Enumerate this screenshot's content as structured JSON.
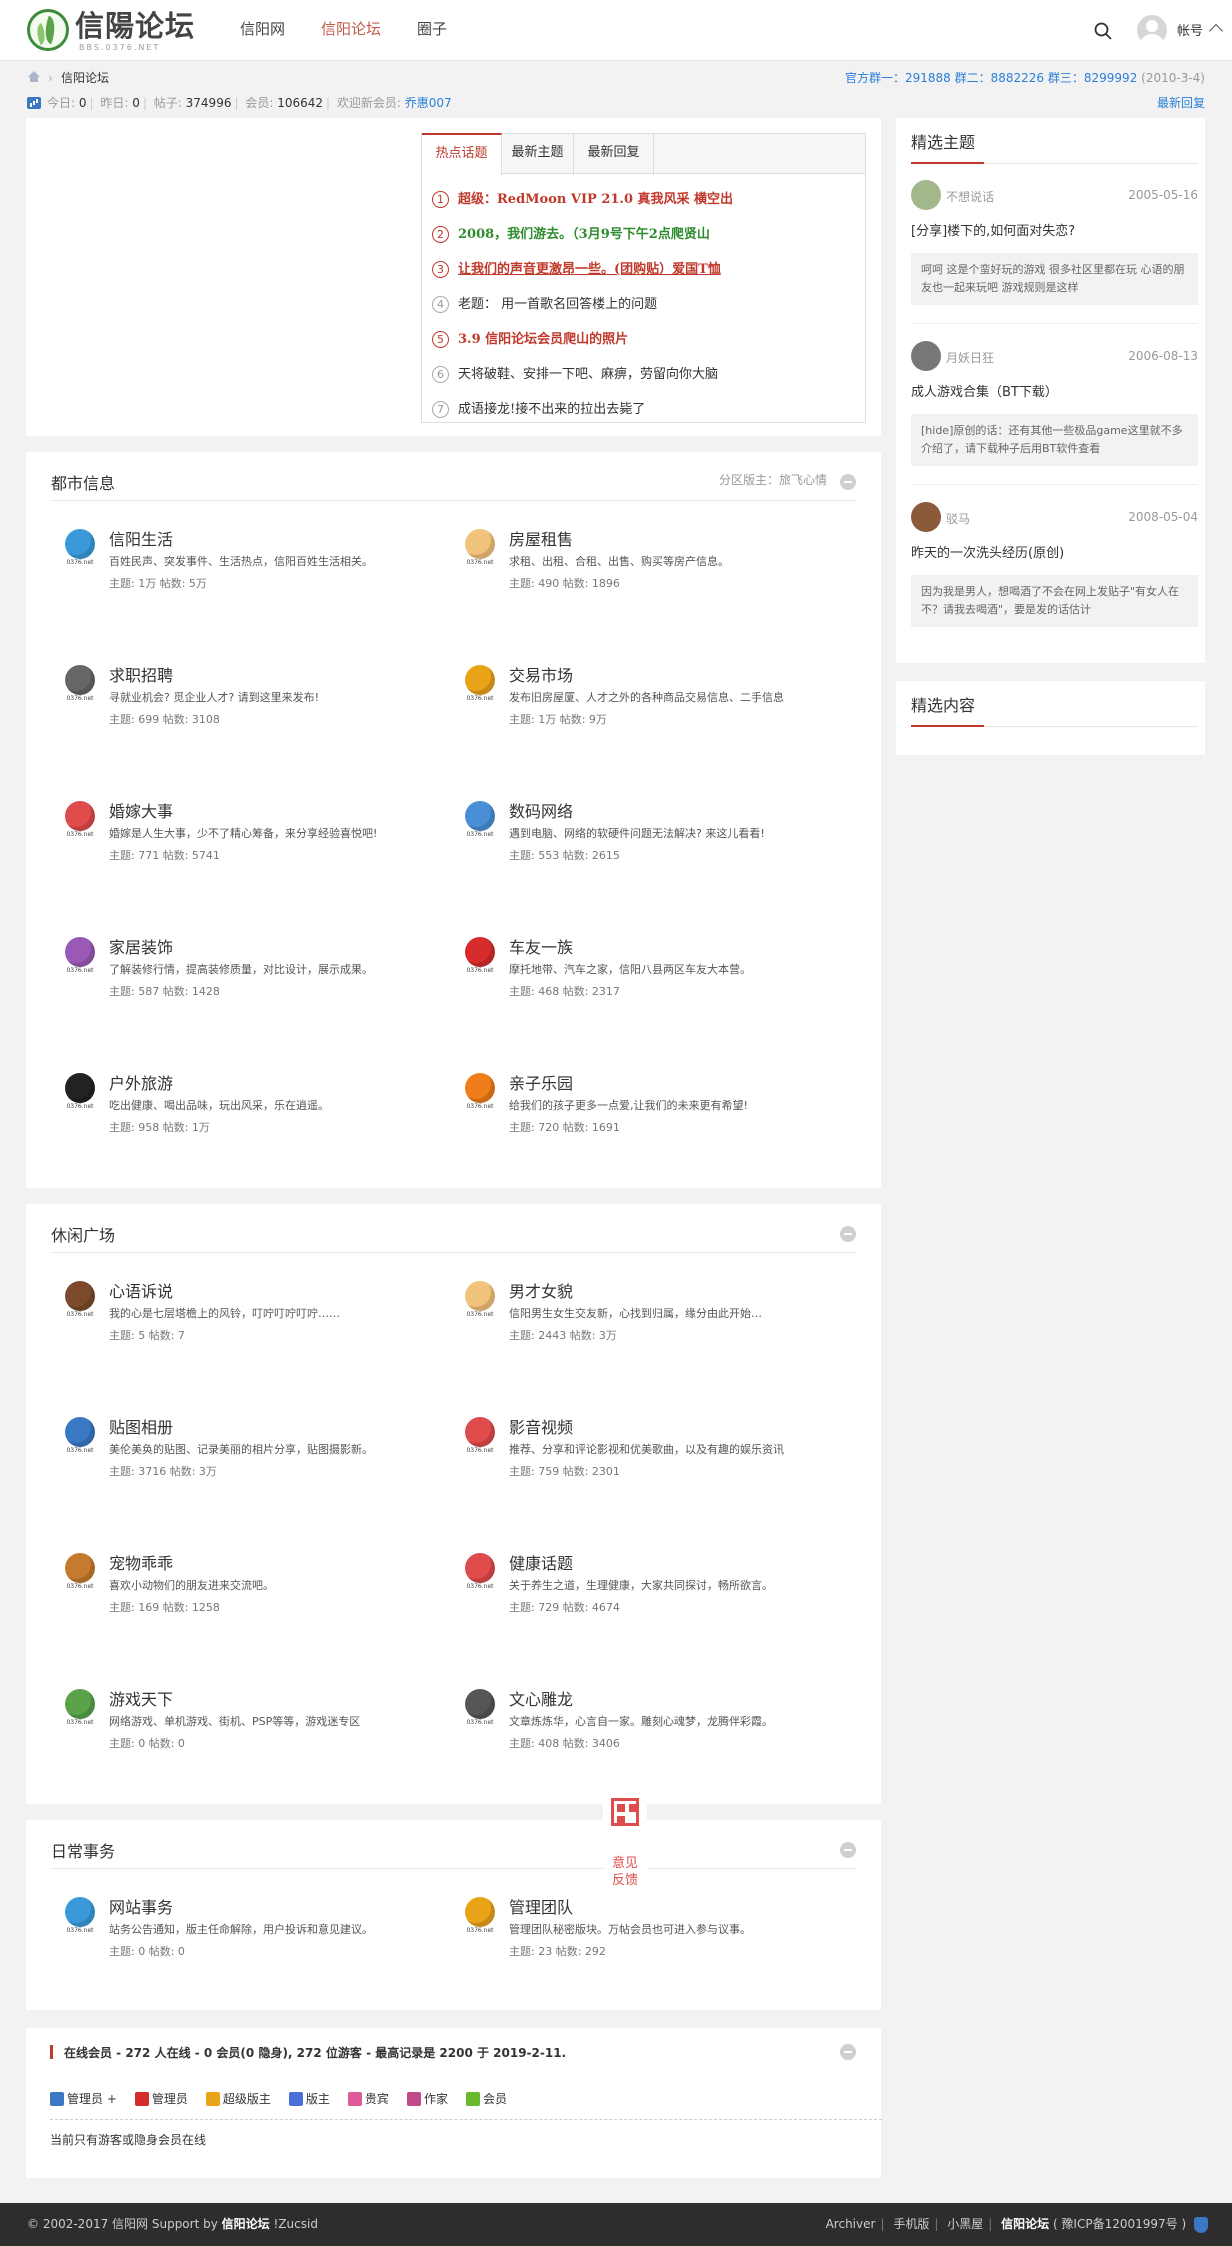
{
  "header": {
    "logo_text": "信陽论坛",
    "logo_sub": "BBS.0376.NET",
    "nav": [
      "信阳网",
      "信阳论坛",
      "圈子"
    ],
    "account": "帐号"
  },
  "breadcrumb": {
    "current": "信阳论坛",
    "qq_groups": "官方群一：291888 群二：8882226 群三：8299992",
    "date": "(2010-3-4)"
  },
  "stats": {
    "today_label": "今日:",
    "today": "0",
    "yesterday_label": "昨日:",
    "yesterday": "0",
    "posts_label": "帖子:",
    "posts": "374996",
    "members_label": "会员:",
    "members": "106642",
    "welcome_label": "欢迎新会员:",
    "newest_member": "乔惠007",
    "new_replies": "最新回复"
  },
  "hot": {
    "tabs": [
      "热点话题",
      "最新主题",
      "最新回复"
    ],
    "items": [
      {
        "n": "1",
        "text": "超级：RedMoon VIP 21.0 真我风采 横空出",
        "color": "#c0392b",
        "bold": true
      },
      {
        "n": "2",
        "text": "2008，我们游去。（3月9号下午2点爬贤山",
        "color": "#2e8b2e",
        "bold": true
      },
      {
        "n": "3",
        "text": "让我们的声音更激昂一些。(团购贴）爱国T恤",
        "color": "#c0392b",
        "bold": true,
        "underline": true
      },
      {
        "n": "4",
        "text": "老题：  用一首歌名回答楼上的问题",
        "color": "#333333",
        "bold": false
      },
      {
        "n": "5",
        "text": "3.9 信阳论坛会员爬山的照片",
        "color": "#c0392b",
        "bold": true
      },
      {
        "n": "6",
        "text": "天将破鞋、安排一下吧、麻痹，劳留向你大脑",
        "color": "#333333",
        "bold": false
      },
      {
        "n": "7",
        "text": "成语接龙!接不出来的拉出去毙了",
        "color": "#333333",
        "bold": false
      }
    ]
  },
  "sections": [
    {
      "title": "都市信息",
      "moderator": "分区版主：旅飞心情",
      "forums": [
        {
          "name": "信阳生活",
          "desc": "百姓民声、突发事件、生活热点，信阳百姓生活相关。",
          "count": "主题: 1万 帖数: 5万",
          "icon": "globe-icon",
          "color": "#3a9ad9"
        },
        {
          "name": "房屋租售",
          "desc": "求租、出租、合租、出售、购买等房产信息。",
          "count": "主题: 490 帖数: 1896",
          "icon": "speech-bubble-icon",
          "color": "#f0c27a"
        },
        {
          "name": "求职招聘",
          "desc": "寻就业机会? 觅企业人才? 请到这里来发布!",
          "count": "主题: 699 帖数: 3108",
          "icon": "compass-icon",
          "color": "#666666"
        },
        {
          "name": "交易市场",
          "desc": "发布旧房屋厦、人才之外的各种商品交易信息、二手信息",
          "count": "主题: 1万 帖数: 9万",
          "icon": "coins-icon",
          "color": "#e8a317"
        },
        {
          "name": "婚嫁大事",
          "desc": "婚嫁是人生大事，少不了精心筹备，来分享经验喜悦吧!",
          "count": "主题: 771 帖数: 5741",
          "icon": "heart-icon",
          "color": "#e04b4b"
        },
        {
          "name": "数码网络",
          "desc": "遇到电脑、网络的软硬件问题无法解决? 来这儿看看!",
          "count": "主题: 553 帖数: 2615",
          "icon": "monitor-icon",
          "color": "#4a8fd6"
        },
        {
          "name": "家居装饰",
          "desc": "了解装修行情，提高装修质量，对比设计，展示成果。",
          "count": "主题: 587 帖数: 1428",
          "icon": "lamp-icon",
          "color": "#9b59b6"
        },
        {
          "name": "车友一族",
          "desc": "摩托地带、汽车之家，信阳八县两区车友大本营。",
          "count": "主题: 468 帖数: 2317",
          "icon": "car-icon",
          "color": "#d62c2c"
        },
        {
          "name": "户外旅游",
          "desc": "吃出健康、喝出品味，玩出风采，乐在逍遥。",
          "count": "主题: 958 帖数: 1万",
          "icon": "camera-icon",
          "color": "#222222"
        },
        {
          "name": "亲子乐园",
          "desc": "给我们的孩子更多一点爱,让我们的未来更有希望!",
          "count": "主题: 720 帖数: 1691",
          "icon": "mushroom-icon",
          "color": "#f07c1a"
        }
      ]
    },
    {
      "title": "休闲广场",
      "moderator": "",
      "forums": [
        {
          "name": "心语诉说",
          "desc": "我的心是七层塔檐上的风铃，叮咛叮咛叮咛……",
          "count": "主题: 5 帖数: 7",
          "icon": "coffee-cup-icon",
          "color": "#7a4a2a"
        },
        {
          "name": "男才女貌",
          "desc": "信阳男生女生交友新，心找到归属，缘分由此开始…",
          "count": "主题: 2443 帖数: 3万",
          "icon": "speech-bubble-icon",
          "color": "#f0c27a"
        },
        {
          "name": "贴图相册",
          "desc": "美伦美奂的贴图、记录美丽的相片分享，贴图摄影新。",
          "count": "主题: 3716 帖数: 3万",
          "icon": "picture-icon",
          "color": "#3a78c4"
        },
        {
          "name": "影音视频",
          "desc": "推荐、分享和评论影视和优美歌曲，以及有趣的娱乐资讯",
          "count": "主题: 759 帖数: 2301",
          "icon": "disc-icon",
          "color": "#e04b4b"
        },
        {
          "name": "宠物乖乖",
          "desc": "喜欢小动物们的朋友进来交流吧。",
          "count": "主题: 169 帖数: 1258",
          "icon": "dog-icon",
          "color": "#c57a2e"
        },
        {
          "name": "健康话题",
          "desc": "关于养生之道，生理健康，大家共同探讨，畅所欲言。",
          "count": "主题: 729 帖数: 4674",
          "icon": "health-pin-icon",
          "color": "#e04b4b"
        },
        {
          "name": "游戏天下",
          "desc": "网络游戏、单机游戏、街机、PSP等等，游戏迷专区",
          "count": "主题: 0 帖数: 0",
          "icon": "gamepad-icon",
          "color": "#5aa34a"
        },
        {
          "name": "文心雕龙",
          "desc": "文章炼炼华，心言自一家。雕刻心魂梦，龙腾伴彩霞。",
          "count": "主题: 408 帖数: 3406",
          "icon": "notebook-icon",
          "color": "#555555"
        }
      ]
    },
    {
      "title": "日常事务",
      "moderator": "",
      "forums": [
        {
          "name": "网站事务",
          "desc": "站务公告通知，版主任命解除，用户投诉和意见建议。",
          "count": "主题: 0 帖数: 0",
          "icon": "bucket-icon",
          "color": "#3a9ad9"
        },
        {
          "name": "管理团队",
          "desc": "管理团队秘密版块。万帖会员也可进入参与议事。",
          "count": "主题: 23 帖数: 292",
          "icon": "lock-icon",
          "color": "#e8a317"
        }
      ]
    }
  ],
  "sidebar": {
    "featured_title": "精选主题",
    "featured": [
      {
        "author": "不想说话",
        "date": "2005-05-16",
        "title": "[分享]楼下的,如何面对失恋?",
        "excerpt": "呵呵 这是个蛮好玩的游戏 很多社区里都在玩 心语的朋友也一起来玩吧 游戏规则是这样",
        "avatar_color": "#a3b88a"
      },
      {
        "author": "月妖日狂",
        "date": "2006-08-13",
        "title": "成人游戏合集（BT下载）",
        "excerpt": "[hide]原创的话：还有其他一些极品game这里就不多介绍了，请下载种子后用BT软件查看",
        "avatar_color": "#777777"
      },
      {
        "author": "驳马",
        "date": "2008-05-04",
        "title": "昨天的一次洗头经历(原创)",
        "excerpt": "因为我是男人，想喝酒了不会在网上发贴子\"有女人在不？请我去喝酒\"，要是发的话估计",
        "avatar_color": "#8a5a3a"
      }
    ],
    "content_title": "精选内容"
  },
  "online": {
    "title": "在线会员 - 272 人在线 - 0 会员(0 隐身), 272 位游客 - 最高记录是 2200 于 2019-2-11.",
    "legend": [
      {
        "label": "管理员 +",
        "color": "#3a78c4"
      },
      {
        "label": "管理员",
        "color": "#d62c2c"
      },
      {
        "label": "超级版主",
        "color": "#e8a317"
      },
      {
        "label": "版主",
        "color": "#4a6fd6"
      },
      {
        "label": "贵宾",
        "color": "#e05a9a"
      },
      {
        "label": "作家",
        "color": "#c04a8a"
      },
      {
        "label": "会员",
        "color": "#6ab82e"
      }
    ],
    "note": "当前只有游客或隐身会员在线"
  },
  "feedback": {
    "line1": "意见",
    "line2": "反馈"
  },
  "footer": {
    "left_copy": "© 2002-2017 信阳网 Support by",
    "left_brand": "信阳论坛",
    "left_tail": "!Zucsid",
    "links": [
      "Archiver",
      "手机版",
      "小黑屋"
    ],
    "brand": "信阳论坛",
    "icp": "( 豫ICP备12001997号 )"
  }
}
